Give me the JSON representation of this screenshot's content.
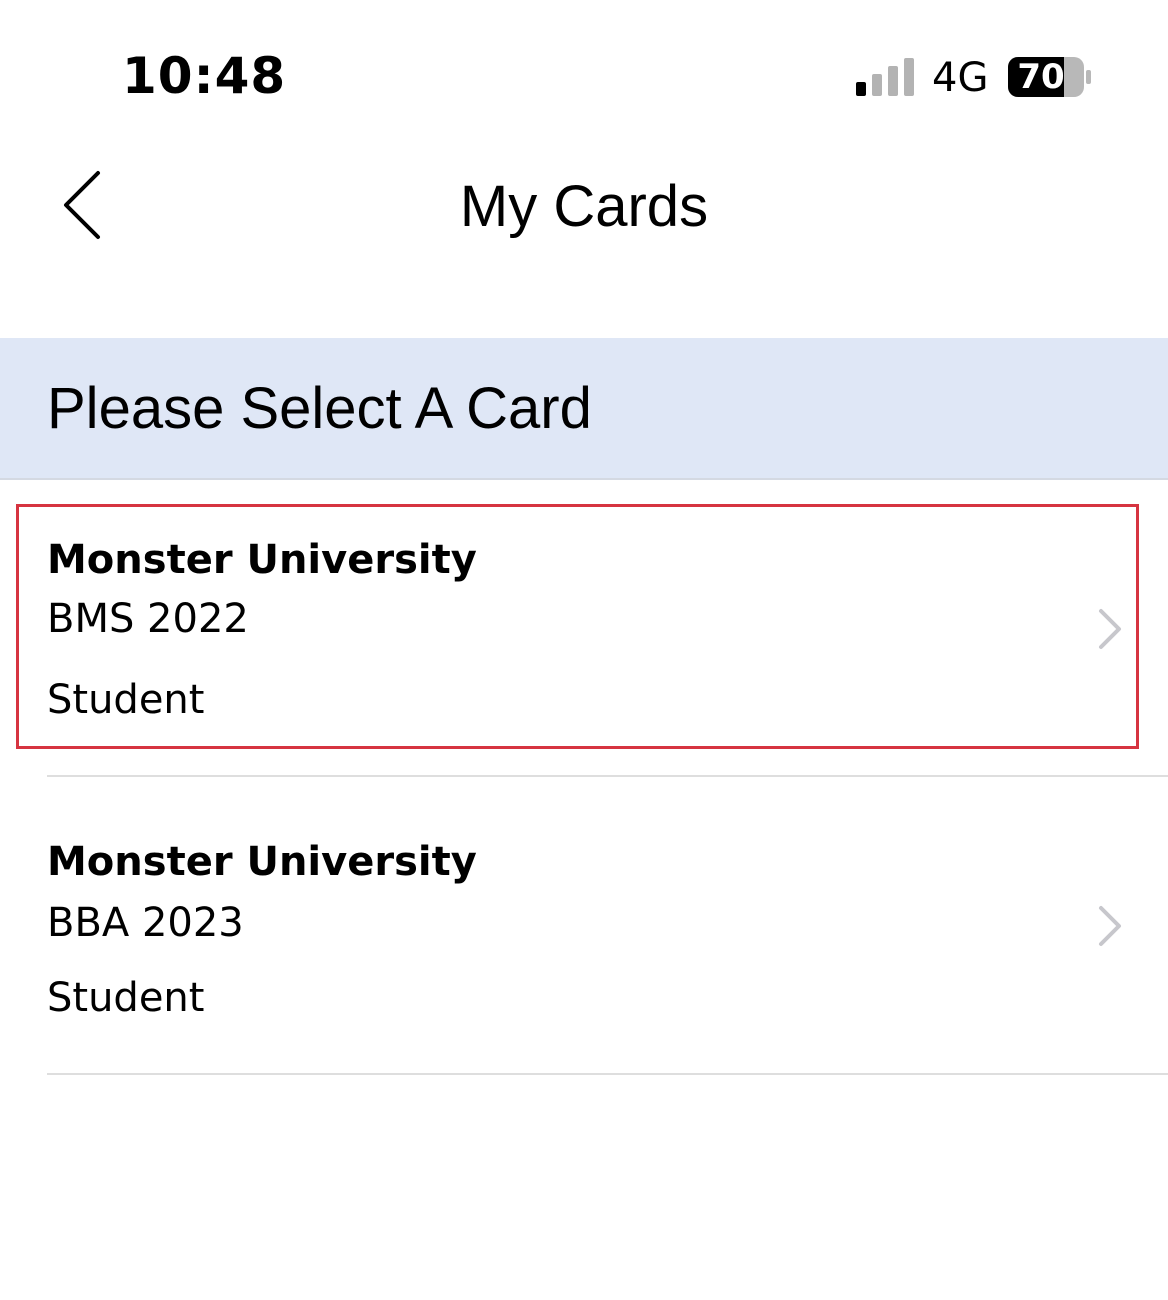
{
  "status_bar": {
    "time": "10:48",
    "network": "4G",
    "battery": "70",
    "signal_bars_active": 1,
    "signal_bars_total": 4
  },
  "header": {
    "title": "My Cards",
    "back_icon": "chevron-left-icon"
  },
  "section": {
    "label": "Please Select A Card",
    "background": "#dfe7f6"
  },
  "cards": [
    {
      "name": "Monster University",
      "program": "BMS 2022",
      "role": "Student",
      "selected": true
    },
    {
      "name": "Monster University",
      "program": "BBA 2023",
      "role": "Student",
      "selected": false
    }
  ],
  "colors": {
    "selection_border": "#d63440",
    "chevron": "#c7c7cc",
    "divider": "#dedede"
  }
}
